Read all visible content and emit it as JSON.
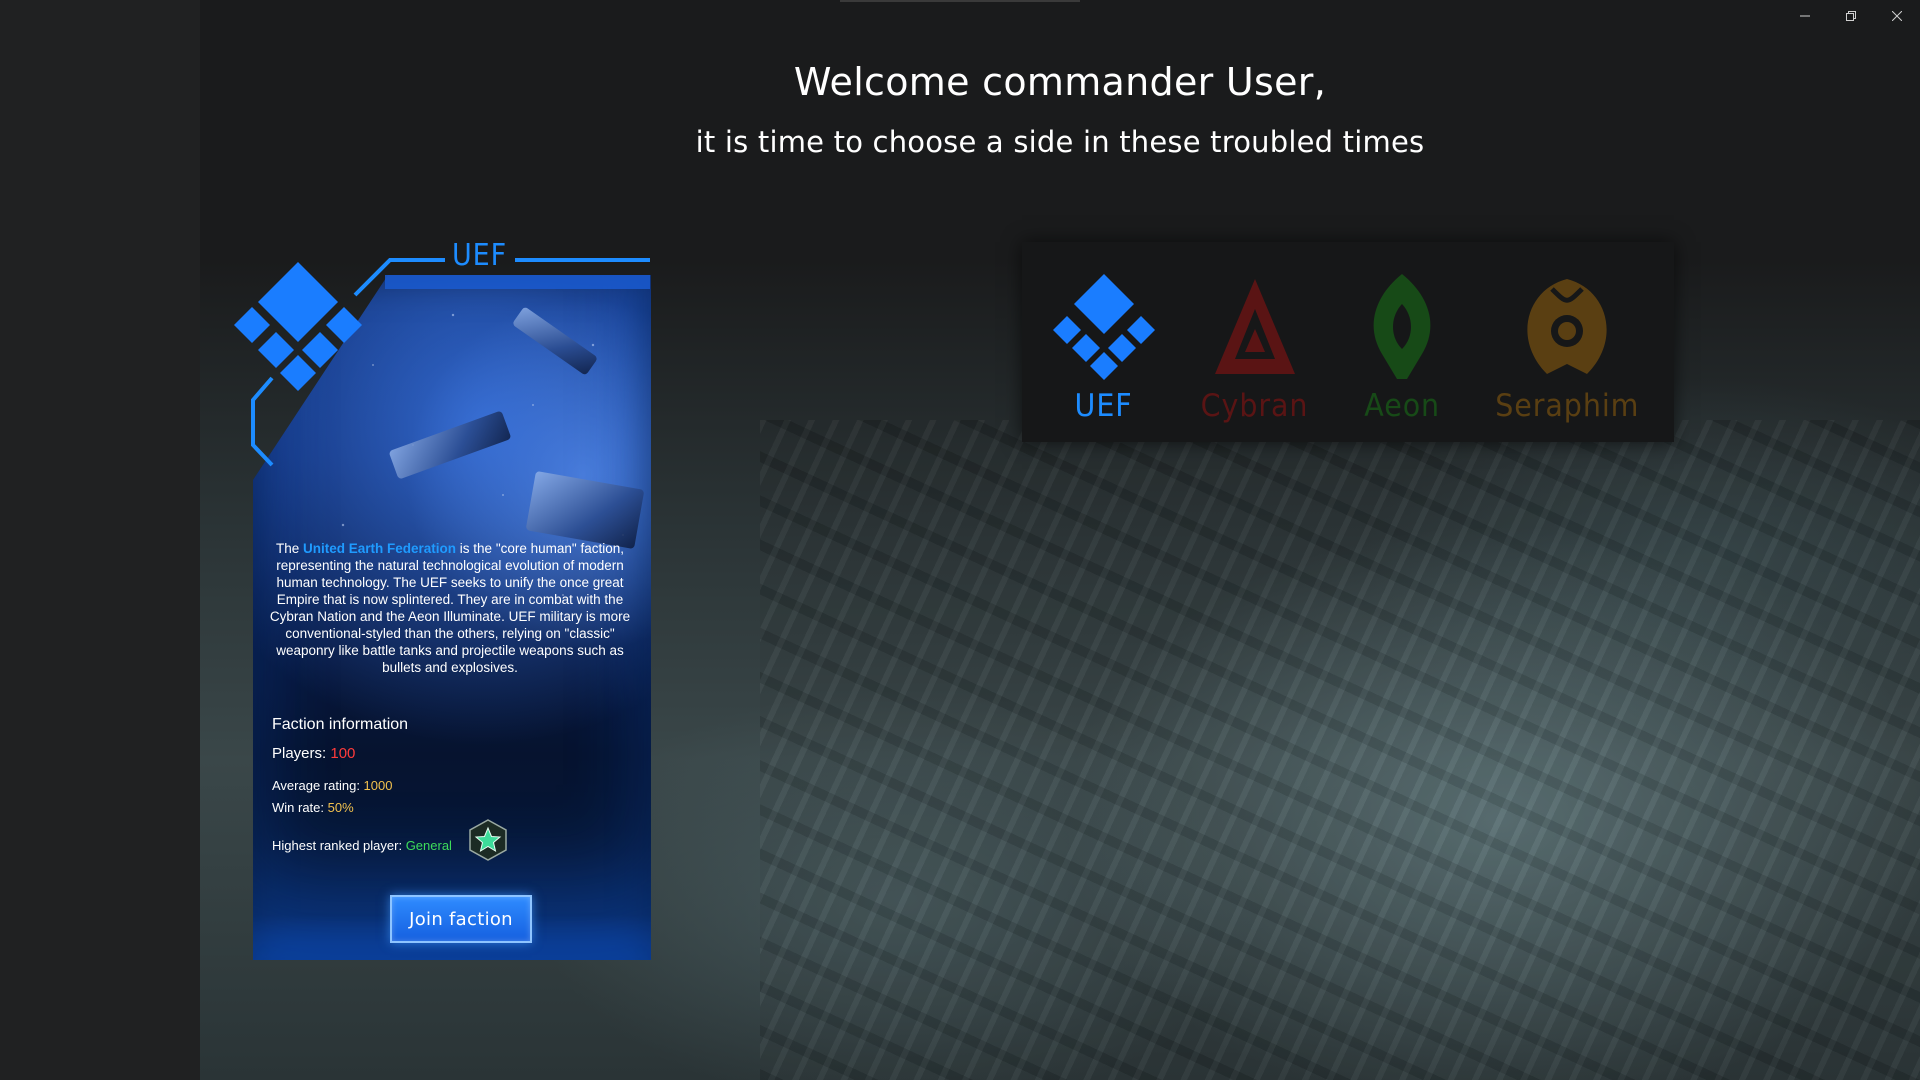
{
  "window": {
    "controls": [
      "minimize",
      "restore",
      "close"
    ]
  },
  "header": {
    "title": "Welcome commander User,",
    "subtitle": "it is time to choose a side in these troubled times"
  },
  "card": {
    "faction_name": "UEF",
    "desc_prefix": "The ",
    "desc_highlight": "United Earth Federation",
    "desc_rest": " is the \"core human\" faction, representing the natural technological evolution of modern human technology. The UEF seeks to unify the once great Empire that is now splintered. They are in combat with the Cybran Nation and the Aeon Illuminate. UEF military is more conventional-styled than the others, relying on \"classic\" weaponry like battle tanks and projectile weapons such as bullets and explosives.",
    "info_heading": "Faction information",
    "players_label": "Players: ",
    "players_value": "100",
    "rating_label": "Average rating: ",
    "rating_value": "1000",
    "winrate_label": "Win rate: ",
    "winrate_value": "50%",
    "highest_label": "Highest ranked player: ",
    "highest_value": "General",
    "join_label": "Join faction"
  },
  "factions": [
    {
      "name": "UEF",
      "color": "#1d8cff",
      "icon": "uef-emblem-icon",
      "selected": true
    },
    {
      "name": "Cybran",
      "color": "#5a1414",
      "icon": "cybran-emblem-icon",
      "selected": false
    },
    {
      "name": "Aeon",
      "color": "#174a17",
      "icon": "aeon-emblem-icon",
      "selected": false
    },
    {
      "name": "Seraphim",
      "color": "#5a3f12",
      "icon": "seraphim-emblem-icon",
      "selected": false
    }
  ],
  "colors": {
    "accent": "#1d8cff",
    "players": "#ff3b3b",
    "rating": "#f2c14e",
    "rank": "#3ddc5a"
  }
}
